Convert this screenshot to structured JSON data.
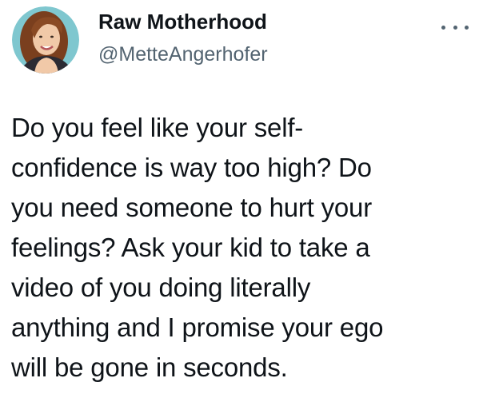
{
  "author": {
    "display_name": "Raw Motherhood",
    "handle": "@MetteAngerhofer",
    "avatar_icon": "profile-photo"
  },
  "menu": {
    "icon": "more-horizontal-icon"
  },
  "tweet": {
    "lines": [
      "Do you feel like your self-",
      "confidence is way too high? Do",
      "you need someone to hurt your",
      "feelings? Ask your kid to take a",
      "video of you doing literally",
      "anything and I promise your ego",
      "will be gone in seconds."
    ]
  },
  "colors": {
    "text_primary": "#0f1419",
    "text_secondary": "#536471",
    "background": "#ffffff"
  }
}
